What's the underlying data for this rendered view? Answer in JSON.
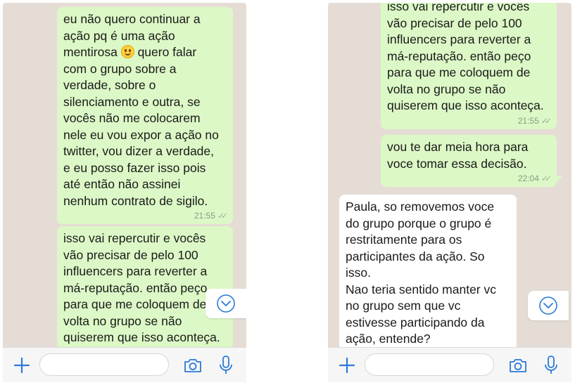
{
  "left": {
    "messages": [
      {
        "direction": "out",
        "lines": [
          "eu não quero continuar a",
          "ação pq é uma ação",
          [
            "mentirosa ",
            ":smiling-face:",
            " quero falar"
          ],
          "com o grupo sobre a",
          "verdade, sobre o",
          "silenciamento e outra, se",
          "vocês não me colocarem",
          "nele eu vou expor a ação no",
          "twitter, vou dizer a verdade,",
          "e eu posso fazer isso pois",
          "até então não assinei",
          "nenhum contrato de sigilo."
        ],
        "time": "21:55"
      },
      {
        "direction": "out",
        "lines": [
          "isso vai repercutir e vocês",
          "vão precisar de pelo 100",
          "influencers para reverter a",
          "má-reputação. então peço",
          "para que me coloquem de",
          "volta no grupo se não",
          "quiserem que isso aconteça."
        ],
        "time": ""
      }
    ]
  },
  "right": {
    "messages": [
      {
        "direction": "out",
        "lines": [
          "isso vai repercutir e vocês",
          "vão precisar de pelo 100",
          "influencers para reverter a",
          "má-reputação. então peço",
          "para que me coloquem de",
          "volta no grupo se não",
          "quiserem que isso aconteça."
        ],
        "time": "21:55"
      },
      {
        "direction": "out",
        "lines": [
          "vou te dar meia hora para",
          "voce tomar essa decisão."
        ],
        "time": "22:04"
      },
      {
        "direction": "in",
        "lines": [
          "Paula, so removemos voce",
          "do grupo porque o grupo é",
          "restritamente para os",
          "participantes da ação. So",
          "isso.",
          "Nao teria sentido manter vc",
          "no grupo sem que vc",
          "estivesse participando da",
          "ação, entende?"
        ],
        "time": ""
      }
    ]
  },
  "icons": {
    "read_receipt": "double-check-icon",
    "scroll_down": "chevron-down-circle-icon",
    "attach": "plus-icon",
    "camera": "camera-icon",
    "microphone": "microphone-icon",
    "emoji": "smiling-face-icon"
  },
  "colors": {
    "outgoing_bubble": "#dcf8c6",
    "incoming_bubble": "#ffffff",
    "chat_background": "#e5ddd5",
    "accent": "#2a7ad8"
  }
}
